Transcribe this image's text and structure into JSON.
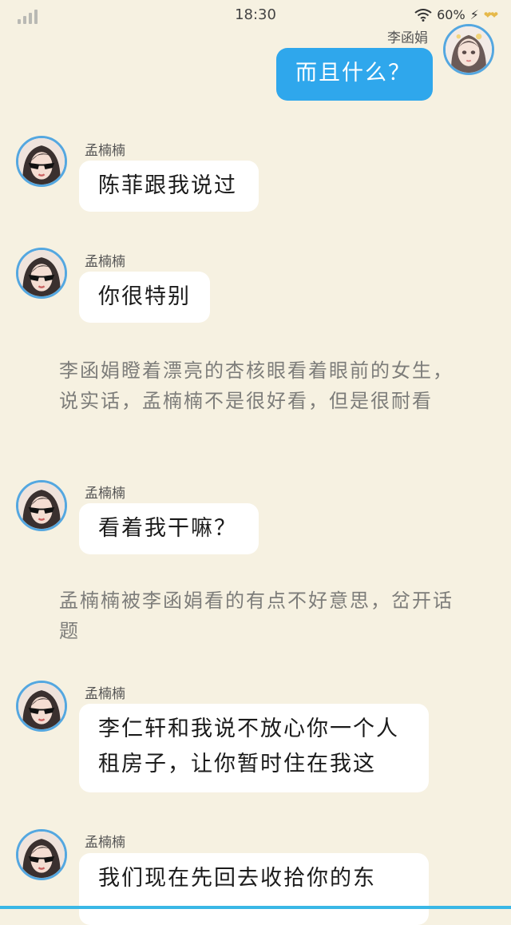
{
  "status": {
    "time": "18:30",
    "battery": "60%",
    "signal_icon": "signal-bars-icon",
    "wifi_icon": "wifi-icon",
    "charging_icon": "charging-bolt-icon"
  },
  "messages": [
    {
      "type": "sent",
      "name": "李函娟",
      "text": "而且什么？"
    },
    {
      "type": "received",
      "name": "孟楠楠",
      "text": "陈菲跟我说过"
    },
    {
      "type": "received",
      "name": "孟楠楠",
      "text": "你很特别"
    },
    {
      "type": "narration",
      "text": "李函娟瞪着漂亮的杏核眼看着眼前的女生，说实话，孟楠楠不是很好看，但是很耐看"
    },
    {
      "type": "received",
      "name": "孟楠楠",
      "text": "看着我干嘛？"
    },
    {
      "type": "narration",
      "text": "孟楠楠被李函娟看的有点不好意思，岔开话题"
    },
    {
      "type": "received",
      "name": "孟楠楠",
      "text": "李仁轩和我说不放心你一个人租房子，让你暂时住在我这"
    },
    {
      "type": "received",
      "name": "孟楠楠",
      "text": "我们现在先回去收拾你的东"
    }
  ],
  "colors": {
    "background": "#f6f1e1",
    "sent_bubble": "#2fa7ec",
    "avatar_ring": "#54a7e0"
  }
}
